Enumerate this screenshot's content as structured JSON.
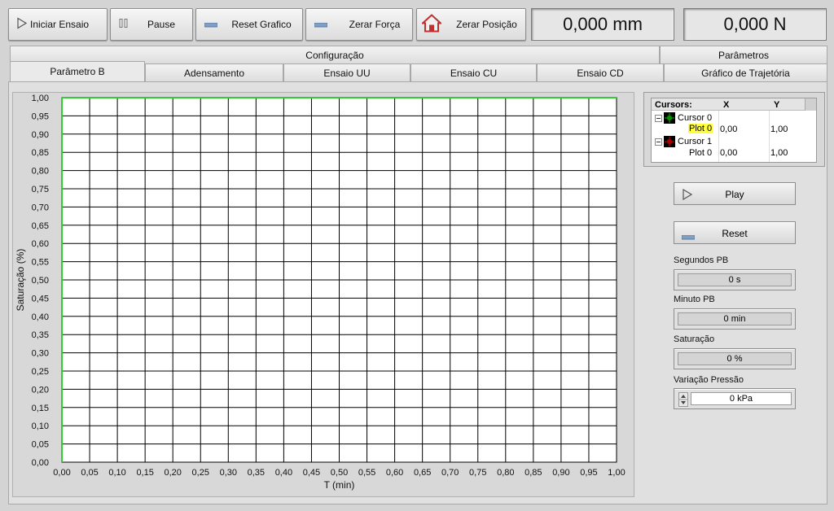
{
  "toolbar": {
    "start_label": "Iniciar Ensaio",
    "pause_label": "Pause",
    "reset_graph_label": "Reset Grafico",
    "zero_force_label": "Zerar Força",
    "zero_position_label": "Zerar Posição"
  },
  "readouts": {
    "displacement": "0,000 mm",
    "force": "0,000 N"
  },
  "tabs_top": [
    {
      "label": "Configuração"
    },
    {
      "label": "Parâmetros"
    }
  ],
  "tabs": [
    {
      "label": "Parâmetro B",
      "active": true
    },
    {
      "label": "Adensamento"
    },
    {
      "label": "Ensaio UU"
    },
    {
      "label": "Ensaio CU"
    },
    {
      "label": "Ensaio CD"
    },
    {
      "label": "Gráfico de Trajetória"
    }
  ],
  "graph": {
    "xlabel": "T (min)",
    "ylabel": "Saturação (%)",
    "xticks": [
      "0,00",
      "0,05",
      "0,10",
      "0,15",
      "0,20",
      "0,25",
      "0,30",
      "0,35",
      "0,40",
      "0,45",
      "0,50",
      "0,55",
      "0,60",
      "0,65",
      "0,70",
      "0,75",
      "0,80",
      "0,85",
      "0,90",
      "0,95",
      "1,00"
    ],
    "yticks": [
      "1,00",
      "0,95",
      "0,90",
      "0,85",
      "0,80",
      "0,75",
      "0,70",
      "0,65",
      "0,60",
      "0,55",
      "0,50",
      "0,45",
      "0,40",
      "0,35",
      "0,30",
      "0,25",
      "0,20",
      "0,15",
      "0,10",
      "0,05",
      "0,00"
    ],
    "line_color": "#32cd32"
  },
  "cursors": {
    "header_name": "Cursors:",
    "header_x": "X",
    "header_y": "Y",
    "rows": [
      {
        "cursor": "Cursor 0",
        "plot": "Plot 0",
        "x": "0,00",
        "y": "1,00",
        "color": "#00c000"
      },
      {
        "cursor": "Cursor 1",
        "plot": "Plot 0",
        "x": "0,00",
        "y": "1,00",
        "color": "#e00000"
      }
    ]
  },
  "controls": {
    "play_label": "Play",
    "reset_label": "Reset",
    "seconds_label": "Segundos PB",
    "seconds_value": "0 s",
    "minutes_label": "Minuto PB",
    "minutes_value": "0 min",
    "saturation_label": "Saturação",
    "saturation_value": "0 %",
    "pressure_label": "Variação Pressão",
    "pressure_value": "0 kPa"
  }
}
